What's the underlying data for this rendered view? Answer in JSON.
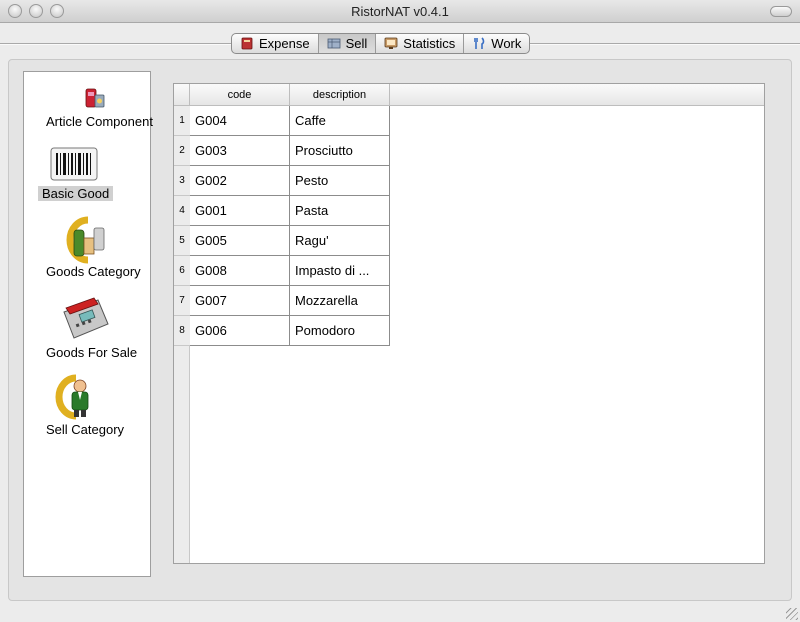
{
  "window": {
    "title": "RistorNAT v0.4.1"
  },
  "tabs": [
    {
      "label": "Expense",
      "icon": "expense-book-icon",
      "active": false
    },
    {
      "label": "Sell",
      "icon": "sell-register-icon",
      "active": true
    },
    {
      "label": "Statistics",
      "icon": "statistics-monitor-icon",
      "active": false
    },
    {
      "label": "Work",
      "icon": "fork-knife-icon",
      "active": false
    }
  ],
  "sidebar": {
    "items": [
      {
        "label": "Article Component",
        "icon": "article-component-icon",
        "selected": false
      },
      {
        "label": "Basic Good",
        "icon": "barcode-icon",
        "selected": true
      },
      {
        "label": "Goods Category",
        "icon": "goods-category-icon",
        "selected": false
      },
      {
        "label": "Goods For Sale",
        "icon": "cash-register-icon",
        "selected": false
      },
      {
        "label": "Sell Category",
        "icon": "sell-category-icon",
        "selected": false
      }
    ]
  },
  "table": {
    "columns": [
      "code",
      "description"
    ],
    "rows": [
      {
        "n": "1",
        "code": "G004",
        "description": "Caffe"
      },
      {
        "n": "2",
        "code": "G003",
        "description": "Prosciutto"
      },
      {
        "n": "3",
        "code": "G002",
        "description": "Pesto"
      },
      {
        "n": "4",
        "code": "G001",
        "description": "Pasta"
      },
      {
        "n": "5",
        "code": "G005",
        "description": "Ragu'"
      },
      {
        "n": "6",
        "code": "G008",
        "description": "Impasto di ..."
      },
      {
        "n": "7",
        "code": "G007",
        "description": "Mozzarella"
      },
      {
        "n": "8",
        "code": "G006",
        "description": "Pomodoro"
      }
    ]
  },
  "colors": {
    "selection": "#d0d0d0",
    "grid": "#8c8c8c"
  }
}
